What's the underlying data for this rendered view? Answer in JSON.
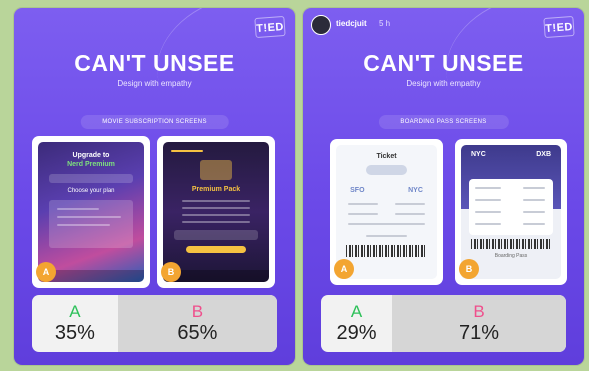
{
  "colors": {
    "page_background": "#b9d59a",
    "card_purple": "#6b49e8",
    "option_a_green": "#2ec15a",
    "option_b_pink": "#ef4f8c",
    "badge_orange": "#f3a531",
    "winner_fill": "#d6d6d6"
  },
  "left_post": {
    "logo": "T!ED",
    "title": "CAN'T UNSEE",
    "subtitle": "Design with empathy",
    "section": "MOVIE SUBSCRIPTION SCREENS",
    "mock_a": {
      "badge": "A",
      "heading": "Upgrade to",
      "plan": "Nerd Premium",
      "cta": "Choose your plan"
    },
    "mock_b": {
      "badge": "B",
      "heading": "Premium Pack"
    },
    "poll": {
      "option_a": {
        "label": "A",
        "percent": "35%",
        "value": 35
      },
      "option_b": {
        "label": "B",
        "percent": "65%",
        "value": 65
      }
    }
  },
  "right_post": {
    "username": "tiedcjuit",
    "time": "5 h",
    "logo": "T!ED",
    "title": "CAN'T UNSEE",
    "subtitle": "Design with empathy",
    "section": "BOARDING PASS SCREENS",
    "mock_a": {
      "badge": "A",
      "heading": "Ticket",
      "from": "SFO",
      "to": "NYC"
    },
    "mock_b": {
      "badge": "B",
      "from": "NYC",
      "to": "DXB",
      "footer": "Boarding Pass"
    },
    "poll": {
      "option_a": {
        "label": "A",
        "percent": "29%",
        "value": 29
      },
      "option_b": {
        "label": "B",
        "percent": "71%",
        "value": 71
      }
    }
  }
}
